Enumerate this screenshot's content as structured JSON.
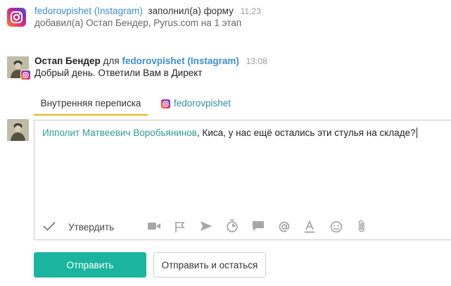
{
  "event": {
    "source": "fedorovpishet (Instagram)",
    "action": "заполнил(а) форму",
    "time": "11:23",
    "detail": "добавил(а) Остап Бендер, Pyrus.com на 1 этап"
  },
  "message": {
    "author": "Остап Бендер",
    "for_word": "для",
    "recipient": "fedorovpishet (Instagram)",
    "time": "13:08",
    "text": "Добрый день. Ответили Вам в Директ"
  },
  "tabs": [
    {
      "label": "Внутренняя переписка",
      "active": true
    },
    {
      "label": "fedorovpishet",
      "active": false
    }
  ],
  "composer": {
    "mention": "Ипполит Матвеевич Воробьянинов",
    "text": ", Киса, у нас ещё остались эти стулья на складе?",
    "approve_label": "Утвердить",
    "toolbar_icons": [
      "video-icon",
      "flag-icon",
      "send-icon",
      "timer-icon",
      "comment-icon",
      "at-icon",
      "text-color-icon",
      "emoji-icon",
      "attach-icon"
    ]
  },
  "buttons": {
    "send": "Отправить",
    "send_and_stay": "Отправить и остаться"
  },
  "colors": {
    "link": "#3d8fd1",
    "accent_tab": "#e5b417",
    "primary": "#1bb59f",
    "mention": "#2a9d8f"
  }
}
